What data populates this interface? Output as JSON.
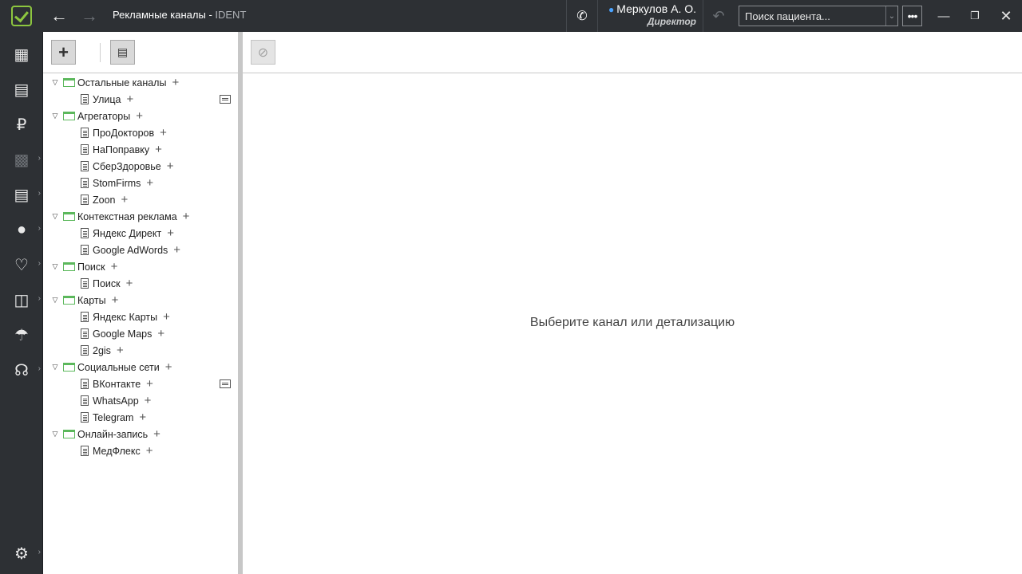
{
  "titlebar": {
    "screen_title": "Рекламные каналы",
    "app_name": "IDENT",
    "separator": " - ",
    "user_name": "Меркулов А. О.",
    "user_role": "Директор",
    "search_placeholder": "Поиск пациента..."
  },
  "sidebar": {
    "items": [
      {
        "icon": "schedule-icon"
      },
      {
        "icon": "tasks-icon"
      },
      {
        "icon": "ruble-icon"
      },
      {
        "icon": "cashbox-icon"
      },
      {
        "icon": "reports-icon"
      },
      {
        "icon": "staff-icon"
      },
      {
        "icon": "tooth-icon"
      },
      {
        "icon": "warehouse-icon"
      },
      {
        "icon": "insurance-icon"
      },
      {
        "icon": "payments-icon"
      },
      {
        "icon": "settings-icon"
      }
    ]
  },
  "tree": {
    "groups": [
      {
        "label": "Остальные каналы",
        "children": [
          "Улица"
        ]
      },
      {
        "label": "Агрегаторы",
        "children": [
          "ПроДокторов",
          "НаПоправку",
          "СберЗдоровье",
          "StomFirms",
          "Zoon"
        ]
      },
      {
        "label": "Контекстная реклама",
        "children": [
          "Яндекс Директ",
          "Google AdWords"
        ]
      },
      {
        "label": "Поиск",
        "children": [
          "Поиск"
        ]
      },
      {
        "label": "Карты",
        "children": [
          "Яндекс Карты",
          "Google Maps",
          "2gis"
        ]
      },
      {
        "label": "Социальные сети",
        "children": [
          "ВКонтакте",
          "WhatsApp",
          "Telegram"
        ]
      },
      {
        "label": "Онлайн-запись",
        "children": [
          "МедФлекс"
        ]
      }
    ]
  },
  "main": {
    "empty_message": "Выберите канал или детализацию"
  },
  "colors": {
    "accent_green": "#8dc63f",
    "folder_green": "#5cb85c",
    "user_icon_blue": "#4aa3ff",
    "chrome_dark": "#2d3034"
  }
}
